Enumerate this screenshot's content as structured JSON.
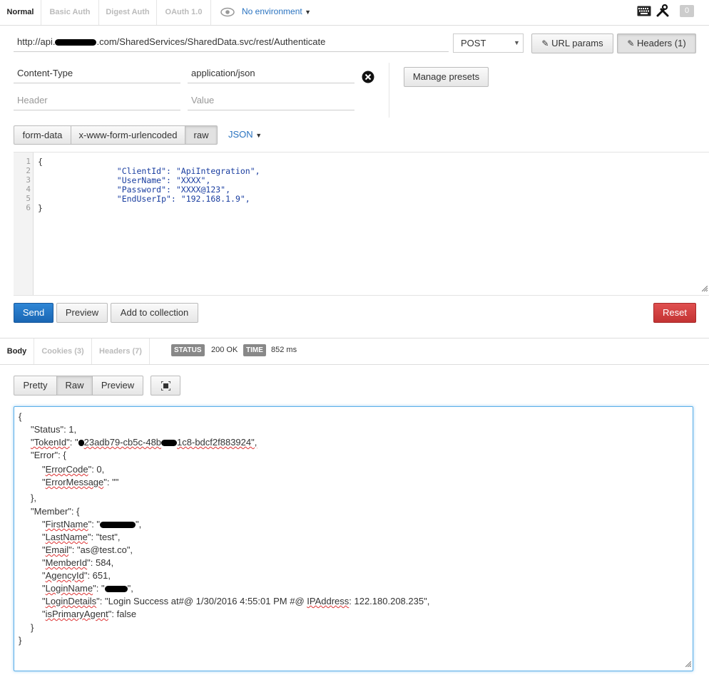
{
  "auth_tabs": [
    "Normal",
    "Basic Auth",
    "Digest Auth",
    "OAuth 1.0"
  ],
  "environment": "No environment",
  "counter": "0",
  "request": {
    "url_prefix": "http://api.",
    "url_suffix": ".com/SharedServices/SharedData.svc/rest/Authenticate",
    "method": "POST",
    "url_params_label": "URL params",
    "headers_label": "Headers (1)"
  },
  "headers": {
    "rows": [
      {
        "key": "Content-Type",
        "value": "application/json"
      }
    ],
    "key_placeholder": "Header",
    "value_placeholder": "Value",
    "manage_presets_label": "Manage presets"
  },
  "body_types": [
    "form-data",
    "x-www-form-urlencoded",
    "raw"
  ],
  "body_format": "JSON",
  "code": {
    "line_numbers": [
      "1",
      "2",
      "3",
      "4",
      "5",
      "6"
    ],
    "lines": [
      "{",
      "                \"ClientId\": \"ApiIntegration\",",
      "                \"UserName\": \"XXXX\",",
      "                \"Password\": \"XXXX@123\",",
      "                \"EndUserIp\": \"192.168.1.9\",",
      "}"
    ]
  },
  "actions": {
    "send": "Send",
    "preview": "Preview",
    "add_to_collection": "Add to collection",
    "reset": "Reset"
  },
  "response_tabs": [
    "Body",
    "Cookies (3)",
    "Headers (7)"
  ],
  "status": {
    "status_label": "STATUS",
    "status_value": "200 OK",
    "time_label": "TIME",
    "time_value": "852 ms"
  },
  "view_modes": [
    "Pretty",
    "Raw",
    "Preview"
  ],
  "response": {
    "open": "{",
    "status": "\"Status\": 1,",
    "token_key": "\"TokenId\"",
    "token_p1": ": \"",
    "token_p2": "23adb79-cb5c-48b",
    "token_p3": "1c8-bdcf2f883924\",",
    "error_key": "\"Error\": {",
    "error_code_key": "ErrorCode",
    "error_code_val": "\": 0,",
    "error_msg_key": "ErrorMessage",
    "error_msg_val": "\": \"\"",
    "error_close": "},",
    "member_key": "\"Member\": {",
    "first_name_key": "FirstName",
    "first_name_val": "\": \"",
    "last_name_key": "LastName",
    "last_name_val": "\": \"test\",",
    "email_key": "Email",
    "email_val": "\": \"as@test.co\",",
    "member_id_key": "MemberId",
    "member_id_val": "\": 584,",
    "agency_id_key": "AgencyId",
    "agency_id_val": "\": 651,",
    "login_name_key": "LoginName",
    "login_name_val": "\": \"",
    "login_details_key": "LoginDetails",
    "login_details_val1": "\": \"Login Success at#@ 1/30/2016 4:55:01 PM #@ ",
    "login_details_ip": "IPAddress",
    "login_details_val2": ": 122.180.208.235\",",
    "primary_key": "isPrimaryAgent",
    "primary_val": "\": false",
    "member_close": "}",
    "close": "}"
  }
}
